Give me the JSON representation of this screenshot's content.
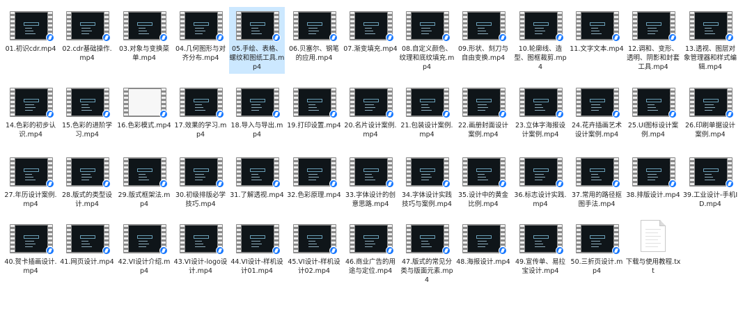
{
  "files": [
    {
      "name": "01.初识cdr.mp4",
      "type": "video"
    },
    {
      "name": "02.cdr基础操作.mp4",
      "type": "video"
    },
    {
      "name": "03.对象与变换菜单.mp4",
      "type": "video"
    },
    {
      "name": "04.几何图形与对齐分布.mp4",
      "type": "video"
    },
    {
      "name": "05.手绘、表格、螺纹和图纸工具.mp4",
      "type": "video",
      "selected": true
    },
    {
      "name": "06.贝塞尔、钢笔的应用.mp4",
      "type": "video"
    },
    {
      "name": "07.渐变填充.mp4",
      "type": "video"
    },
    {
      "name": "08.自定义颜色、纹理和底纹填充.mp4",
      "type": "video"
    },
    {
      "name": "09.形状、刻刀与自由变换.mp4",
      "type": "video"
    },
    {
      "name": "10.轮廓线、造型、图框裁剪.mp4",
      "type": "video"
    },
    {
      "name": "11.文字文本.mp4",
      "type": "video"
    },
    {
      "name": "12.调和、变形、透明、阴影和封套工具.mp4",
      "type": "video"
    },
    {
      "name": "13.透视、图层对象管理器和样式编辑.mp4",
      "type": "video"
    },
    {
      "name": "14.色彩的初步认识.mp4",
      "type": "video"
    },
    {
      "name": "15.色彩的进阶学习.mp4",
      "type": "video"
    },
    {
      "name": "16.色彩模式.mp4",
      "type": "video",
      "light": true
    },
    {
      "name": "17.效果的学习.mp4",
      "type": "video"
    },
    {
      "name": "18.导入与导出.mp4",
      "type": "video"
    },
    {
      "name": "19.打印设置.mp4",
      "type": "video"
    },
    {
      "name": "20.名片设计案例.mp4",
      "type": "video"
    },
    {
      "name": "21.包装设计案例.mp4",
      "type": "video"
    },
    {
      "name": "22.画册封面设计案例.mp4",
      "type": "video"
    },
    {
      "name": "23.立体字海报设计案例.mp4",
      "type": "video"
    },
    {
      "name": "24.花卉插画艺术设计案例.mp4",
      "type": "video"
    },
    {
      "name": "25.UI图标设计案例.mp4",
      "type": "video"
    },
    {
      "name": "26.印刷单据设计案例.mp4",
      "type": "video"
    },
    {
      "name": "27.年历设计案例.mp4",
      "type": "video"
    },
    {
      "name": "28.版式的类型设计.mp4",
      "type": "video"
    },
    {
      "name": "29.版式框架法.mp4",
      "type": "video"
    },
    {
      "name": "30.初级排版必学技巧.mp4",
      "type": "video"
    },
    {
      "name": "31.了解透视.mp4",
      "type": "video"
    },
    {
      "name": "32.色彩原理.mp4",
      "type": "video"
    },
    {
      "name": "33.字体设计的创意思路.mp4",
      "type": "video"
    },
    {
      "name": "34.字体设计实践技巧与案例.mp4",
      "type": "video"
    },
    {
      "name": "35.设计中的黄金比例.mp4",
      "type": "video"
    },
    {
      "name": "36.标志设计实践.mp4",
      "type": "video"
    },
    {
      "name": "37.常用的路径抠图手法.mp4",
      "type": "video"
    },
    {
      "name": "38.排版设计.mp4",
      "type": "video"
    },
    {
      "name": "39.工业设计-手机ID.mp4",
      "type": "video"
    },
    {
      "name": "40.贺卡插画设计.mp4",
      "type": "video"
    },
    {
      "name": "41.网页设计.mp4",
      "type": "video"
    },
    {
      "name": "42.VI设计介绍.mp4",
      "type": "video"
    },
    {
      "name": "43.VI设计-logo设计.mp4",
      "type": "video"
    },
    {
      "name": "44.VI设计-样机设计01.mp4",
      "type": "video"
    },
    {
      "name": "45.VI设计-样机设计02.mp4",
      "type": "video"
    },
    {
      "name": "46.商业广告的用途与定位.mp4",
      "type": "video"
    },
    {
      "name": "47.版式的常见分类与版面元素.mp4",
      "type": "video"
    },
    {
      "name": "48.海报设计.mp4",
      "type": "video"
    },
    {
      "name": "49.宣传单、易拉宝设计.mp4",
      "type": "video"
    },
    {
      "name": "50.三折页设计.mp4",
      "type": "video"
    },
    {
      "name": "下载与使用教程.txt",
      "type": "text"
    }
  ]
}
